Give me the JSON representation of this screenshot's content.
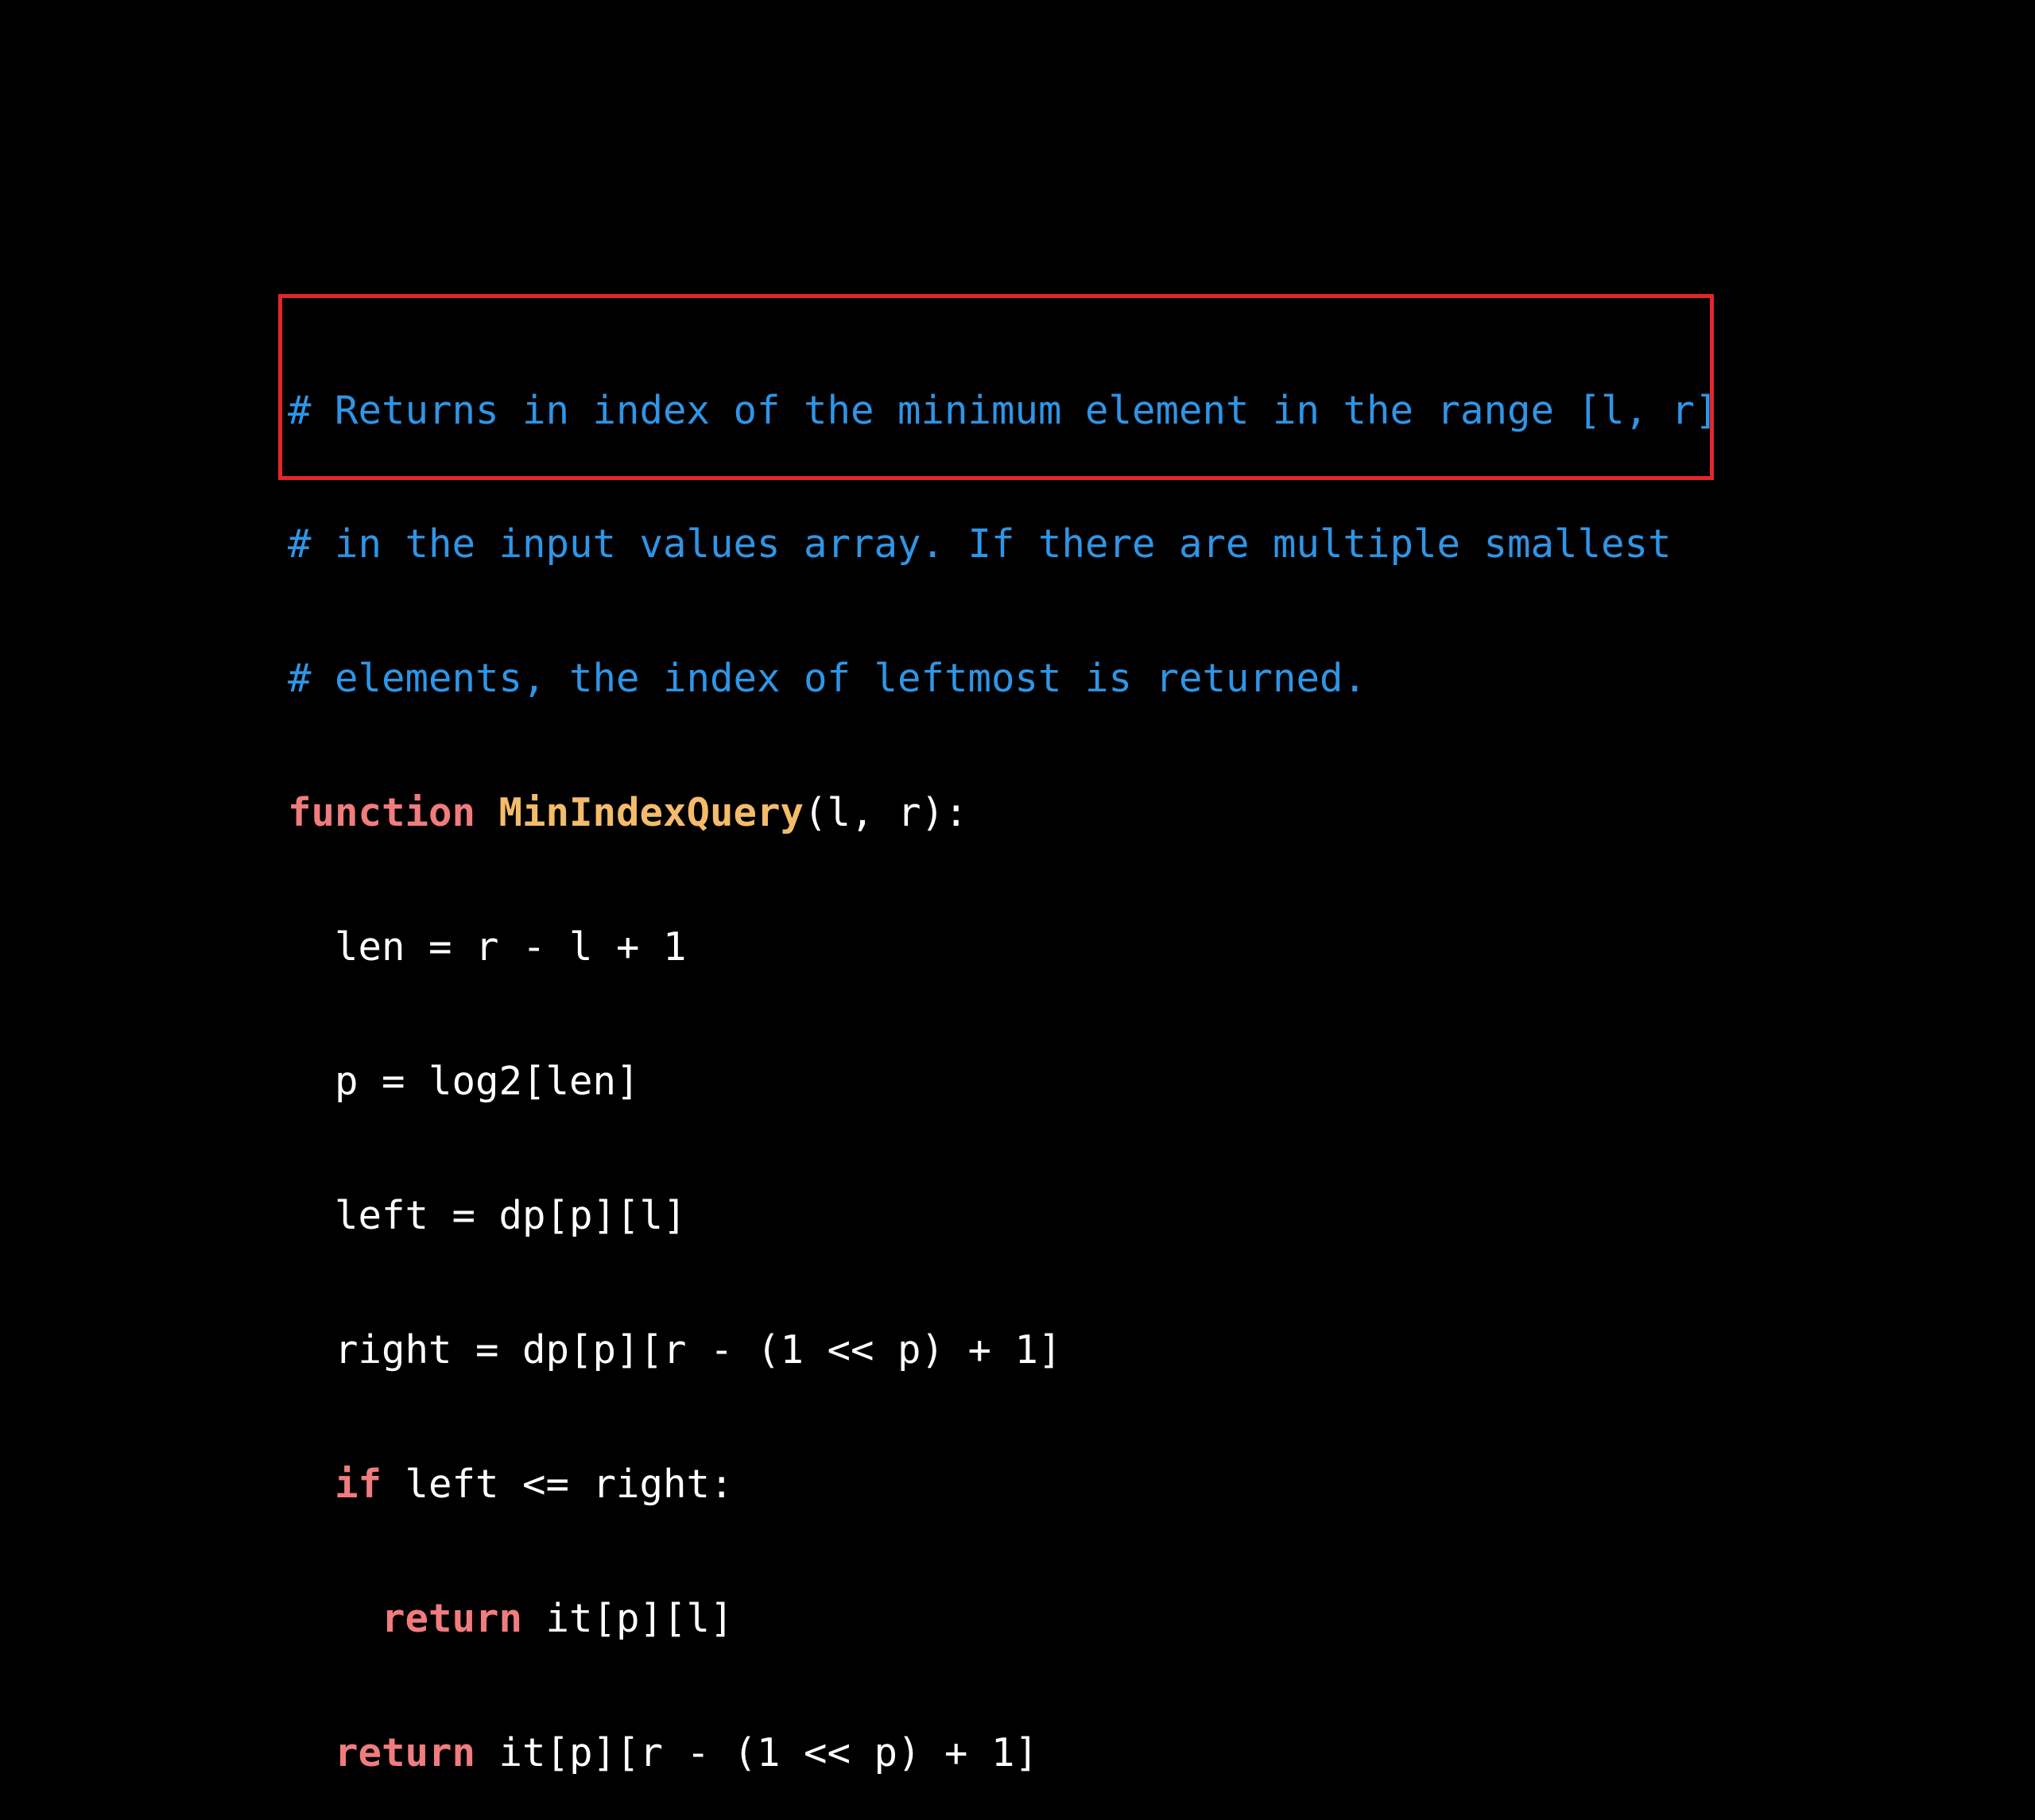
{
  "colors": {
    "background": "#000000",
    "comment": "#2f95e6",
    "keyword": "#f07c7e",
    "function_name": "#f3bb6b",
    "text": "#ffffff",
    "highlight_border": "#e3262a"
  },
  "code": {
    "comment_lines": [
      "# Returns in index of the minimum element in the range [l, r]",
      "# in the input values array. If there are multiple smallest",
      "# elements, the index of leftmost is returned."
    ],
    "signature": {
      "keyword": "function",
      "name": "MinIndexQuery",
      "params": "(l, r):"
    },
    "body": {
      "line1": "len = r - l + 1",
      "line2": "p = log2[len]",
      "line3": "left = dp[p][l]",
      "line4": "right = dp[p][r - (1 << p) + 1]",
      "if_keyword": "if",
      "if_condition": " left <= right:",
      "return_keyword": "return",
      "return1_expr": " it[p][l]",
      "return2_expr": " it[p][r - (1 << p) + 1]"
    }
  }
}
